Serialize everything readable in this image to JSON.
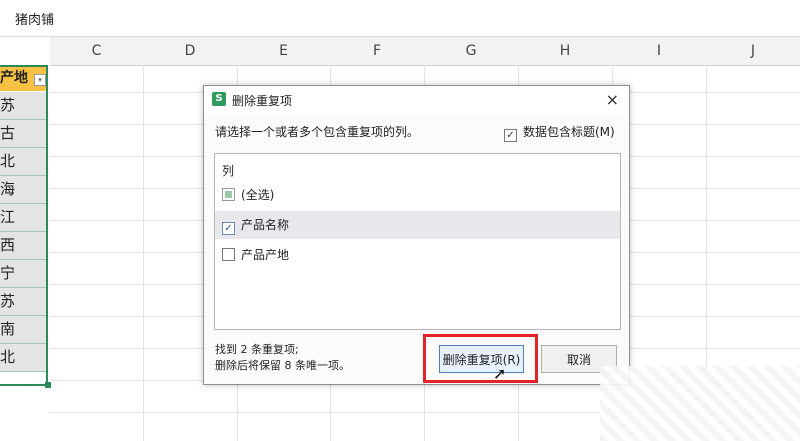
{
  "formula_bar": {
    "text": "猪肉铺"
  },
  "columns": [
    "C",
    "D",
    "E",
    "F",
    "G",
    "H",
    "I",
    "J"
  ],
  "column_a": {
    "header": "产地",
    "filter_icon": "▾",
    "cells": [
      "苏",
      "古",
      "北",
      "海",
      "江",
      "西",
      "宁",
      "苏",
      "南",
      "北"
    ]
  },
  "dialog": {
    "title": "删除重复项",
    "logo_glyph": "S",
    "close_glyph": "×",
    "instruction": "请选择一个或者多个包含重复项的列。",
    "header_checkbox": {
      "label": "数据包含标题(M)",
      "checked": true
    },
    "list_header": "列",
    "items": [
      {
        "label": "(全选)",
        "state": "partial"
      },
      {
        "label": "产品名称",
        "state": "checked"
      },
      {
        "label": "产品产地",
        "state": "unchecked"
      }
    ],
    "status_line1": "找到 2 条重复项;",
    "status_line2": "删除后将保留 8 条唯一项。",
    "delete_button": "删除重复项(R)",
    "cancel_button": "取消"
  },
  "colors": {
    "accent_green": "#2b8a57",
    "header_yellow": "#f7c244",
    "highlight_red": "#e2232a"
  }
}
